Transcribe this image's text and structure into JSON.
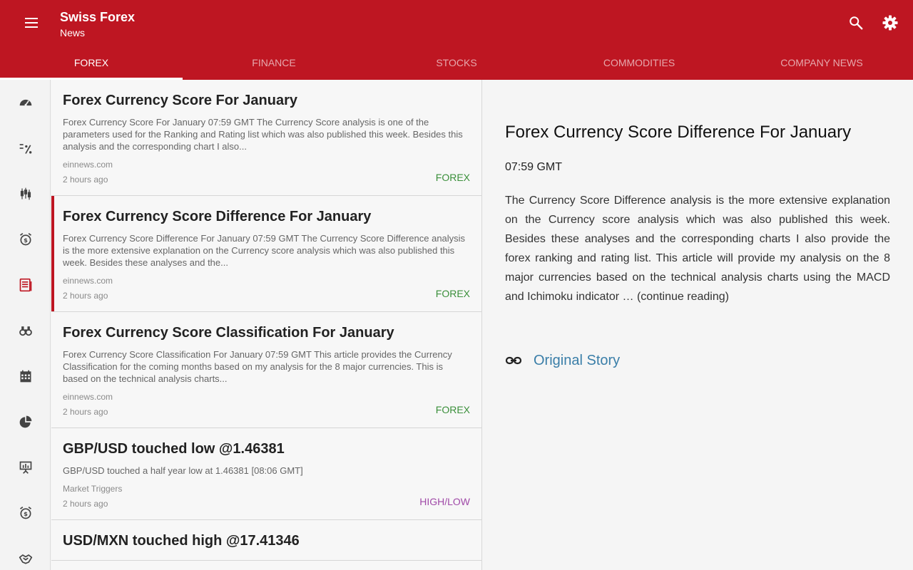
{
  "app": {
    "title": "Swiss Forex",
    "subtitle": "News"
  },
  "tabs": [
    "FOREX",
    "FINANCE",
    "STOCKS",
    "COMMODITIES",
    "COMPANY NEWS"
  ],
  "active_tab": "FOREX",
  "rail_icons": [
    "speedometer-icon",
    "percent-icon",
    "candlestick-icon",
    "alarm-dollar-icon",
    "news-icon",
    "binoculars-icon",
    "calendar-icon",
    "pie-chart-icon",
    "presentation-icon",
    "alarm-dollar-icon",
    "handshake-icon"
  ],
  "articles": [
    {
      "title": "Forex Currency Score For January",
      "body": "Forex Currency Score For January 07:59 GMT The Currency Score analysis is one of the parameters used for the Ranking and Rating list which was also published this week. Besides this analysis and the corresponding chart I also...",
      "source": "einnews.com",
      "time": "2 hours ago",
      "category": "FOREX"
    },
    {
      "title": "Forex Currency Score Difference For January",
      "body": "Forex Currency Score Difference For January 07:59 GMT The Currency Score Difference analysis is the more extensive explanation on the Currency score analysis which was also published this week. Besides these analyses and the...",
      "source": "einnews.com",
      "time": "2 hours ago",
      "category": "FOREX"
    },
    {
      "title": "Forex Currency Score Classification For January",
      "body": "Forex Currency Score Classification For January 07:59 GMT This article provides the Currency Classification for the coming months based on my analysis for the 8 major currencies. This is based on the technical analysis charts...",
      "source": "einnews.com",
      "time": "2 hours ago",
      "category": "FOREX"
    },
    {
      "title": "GBP/USD touched low @1.46381",
      "body": "GBP/USD touched a half year low at 1.46381 [08:06 GMT]",
      "source": "Market Triggers",
      "time": "2 hours ago",
      "category": "HIGH/LOW"
    },
    {
      "title": "USD/MXN touched high @17.41346",
      "body": "",
      "source": "",
      "time": "",
      "category": ""
    }
  ],
  "detail": {
    "title": "Forex Currency Score Difference For January",
    "time": "07:59 GMT",
    "body": "The Currency Score Difference analysis is the more extensive explanation on the Currency score analysis which was also published this week. Besides these analyses and the corresponding charts I also provide the forex ranking and rating list. This article will provide my analysis on the 8 major currencies based on the technical analysis charts using the MACD and Ichimoku indicator … (continue reading)",
    "link_label": "Original Story"
  },
  "colors": {
    "primary": "#be1622",
    "forex": "#3a8f3a",
    "highlow": "#a04aa8",
    "link": "#3a7ea8"
  }
}
